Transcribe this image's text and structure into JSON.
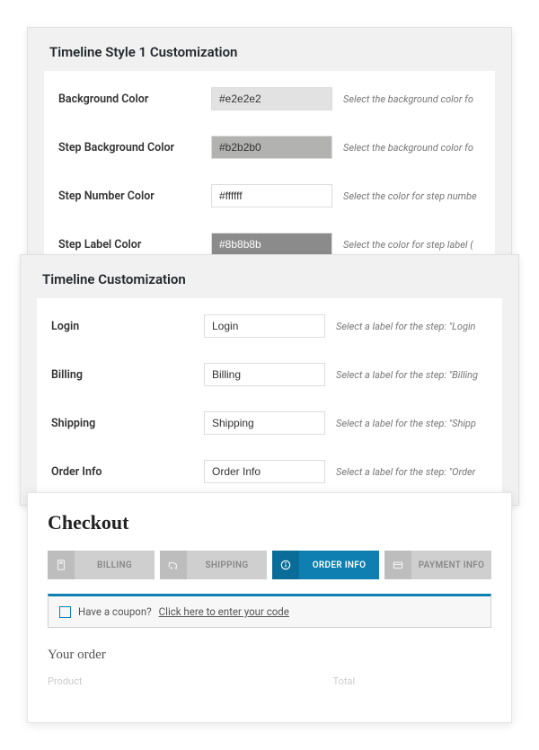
{
  "card1": {
    "title": "Timeline Style 1 Customization",
    "rows": {
      "bg": {
        "label": "Background Color",
        "value": "#e2e2e2",
        "desc": "Select the background color fo"
      },
      "stepbg": {
        "label": "Step Background Color",
        "value": "#b2b2b0",
        "desc": "Select the background color fo"
      },
      "stepnum": {
        "label": "Step Number Color",
        "value": "#ffffff",
        "desc": "Select the color for step numbe"
      },
      "steplbl": {
        "label": "Step Label Color",
        "value": "#8b8b8b",
        "desc": "Select the color for step label ("
      }
    }
  },
  "card2": {
    "title": "Timeline Customization",
    "rows": {
      "login": {
        "label": "Login",
        "value": "Login",
        "desc": "Select a label for the step: \"Login"
      },
      "billing": {
        "label": "Billing",
        "value": "Billing",
        "desc": "Select a label for the step: \"Billing"
      },
      "shipping": {
        "label": "Shipping",
        "value": "Shipping",
        "desc": "Select a label for the step: \"Shipp"
      },
      "order": {
        "label": "Order Info",
        "value": "Order Info",
        "desc": "Select a label for the step: \"Order"
      }
    }
  },
  "checkout": {
    "title": "Checkout",
    "steps": {
      "billing": "BILLING",
      "shipping": "SHIPPING",
      "order": "ORDER INFO",
      "payment": "PAYMENT INFO"
    },
    "coupon_text": "Have a coupon?",
    "coupon_link": "Click here to enter your code",
    "your_order": "Your order",
    "col_product": "Product",
    "col_total": "Total"
  }
}
